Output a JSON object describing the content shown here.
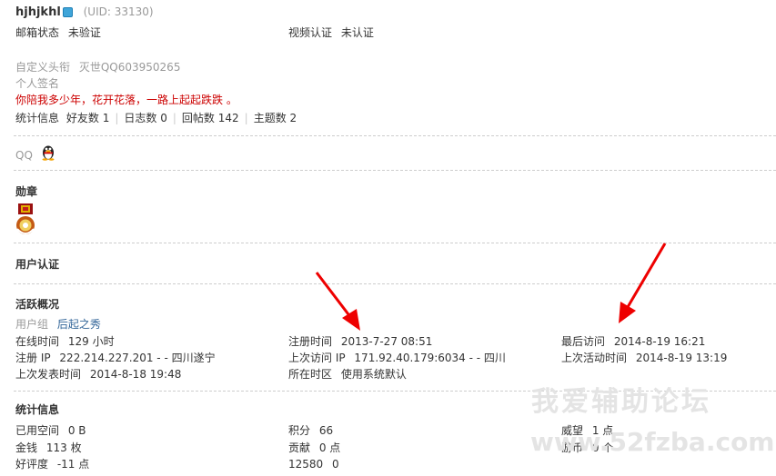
{
  "profile": {
    "username": "hjhjkhl",
    "uid": "(UID: 33130)",
    "email_label": "邮箱状态",
    "email_value": "未验证",
    "video_label": "视频认证",
    "video_value": "未认证",
    "title_label": "自定义头衔",
    "title_value": "灭世QQ603950265",
    "signature_label": "个人签名",
    "signature_text": "你陪我多少年，花开花落，一路上起起跌跌 。",
    "stats_label": "统计信息",
    "stats": [
      {
        "label": "好友数",
        "value": "1"
      },
      {
        "label": "日志数",
        "value": "0"
      },
      {
        "label": "回帖数",
        "value": "142"
      },
      {
        "label": "主题数",
        "value": "2"
      }
    ],
    "qq_label": "QQ"
  },
  "medals": {
    "heading": "勋章"
  },
  "auth": {
    "heading": "用户认证"
  },
  "activity": {
    "heading": "活跃概况",
    "group_label": "用户组",
    "group_value": "后起之秀",
    "online_label": "在线时间",
    "online_value": "129 小时",
    "reg_time_label": "注册时间",
    "reg_time_value": "2013-7-27 08:51",
    "last_visit_label": "最后访问",
    "last_visit_value": "2014-8-19 16:21",
    "reg_ip_label": "注册 IP",
    "reg_ip_value": "222.214.227.201 - - 四川遂宁",
    "last_ip_label": "上次访问 IP",
    "last_ip_value": "171.92.40.179:6034 - - 四川",
    "last_active_label": "上次活动时间",
    "last_active_value": "2014-8-19 13:19",
    "last_post_label": "上次发表时间",
    "last_post_value": "2014-8-18 19:48",
    "timezone_label": "所在时区",
    "timezone_value": "使用系统默认"
  },
  "statistics": {
    "heading": "统计信息",
    "space_label": "已用空间",
    "space_value": "0 B",
    "points_label": "积分",
    "points_value": "66",
    "prestige_label": "威望",
    "prestige_value": "1 点",
    "money_label": "金钱",
    "money_value": "113 枚",
    "contrib_label": "贡献",
    "contrib_value": "0 点",
    "coins_label": "游币",
    "coins_value": "0 个",
    "rating_label": "好评度",
    "rating_value": "-11 点",
    "extra_label": "12580",
    "extra_value": "0"
  },
  "watermark": {
    "title": "我爱辅助论坛",
    "url": "www.52fzba.com"
  },
  "colors": {
    "signature": "#cc0000",
    "link": "#336699",
    "arrow": "#ee0000",
    "online_badge": "#3fa5d9"
  }
}
